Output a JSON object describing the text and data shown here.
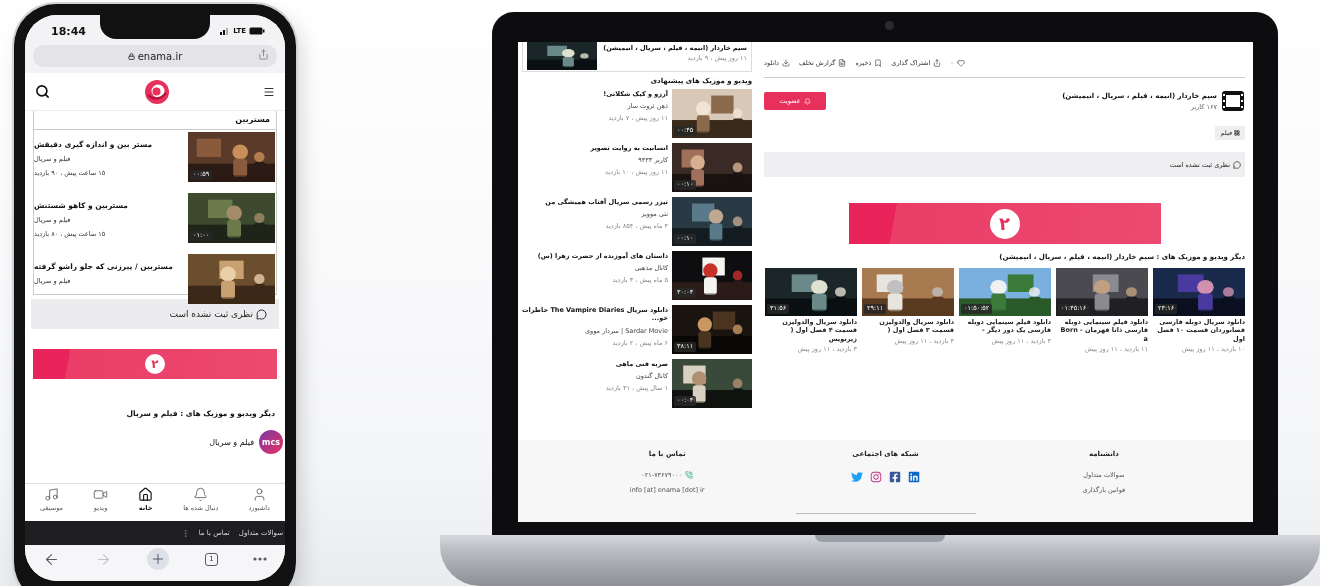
{
  "phone": {
    "status": {
      "time": "18:44",
      "network": "LTE"
    },
    "address": "enama.ir",
    "section_title": "مستربین",
    "videos": [
      {
        "title": "مستر بین و اندازه گیری دقیقش",
        "channel": "فیلم و سریال",
        "meta": "۱۵ ساعت پیش ، ۹۰ بازدید",
        "duration": "۰۰:۵۹"
      },
      {
        "title": "مستربین و کاهو شستنش",
        "channel": "فیلم و سریال",
        "meta": "۱۵ ساعت پیش ، ۸۰ بازدید",
        "duration": "۰۱:۰۰"
      },
      {
        "title": "مستربین / پیرزنی که جلو راشو گرفته",
        "channel": "فیلم و سریال"
      }
    ],
    "comments": "نظری ثبت نشده است",
    "pager": "۲",
    "related_heading": "دیگر ویدیو و موزیک های : فیلم و سریال",
    "channel": {
      "logo": "mcs",
      "name": "فیلم و سریال"
    },
    "nav": [
      {
        "kind": "user",
        "label": "داشبورد",
        "selected": false
      },
      {
        "kind": "bell",
        "label": "دنبال شده ها",
        "selected": false
      },
      {
        "kind": "home",
        "label": "خانه",
        "selected": true
      },
      {
        "kind": "video",
        "label": "ویدیو",
        "selected": false
      },
      {
        "kind": "music",
        "label": "موسیقی",
        "selected": false
      }
    ],
    "footer_links": [
      "سوالات متداول",
      "تماس با ما"
    ],
    "browser": {
      "tab_count": "1",
      "forward_disabled": true
    }
  },
  "laptop": {
    "sidebar": {
      "top_card": {
        "title": "سیم خاردار (انیمه ، فیلم ، سریال ، انیمیشن)",
        "meta": "۱۱ روز پیش ، ۹ بازدید"
      },
      "heading": "ویدیو و موزیک های پیشنهادی",
      "items": [
        {
          "title": "آرزو و کیک شکلاتی!",
          "channel": "ذهن ثروت ساز",
          "meta": "۱۱ روز پیش ، ۷ بازدید",
          "duration": "۰۰:۴۵"
        },
        {
          "title": "انسانیت به روایت تصویر",
          "channel": "کاربر ۹۴۳۳",
          "meta": "۱۱ روز پیش ، ۱۰ بازدید",
          "duration": "۰۰:۱۰"
        },
        {
          "title": "تیزر رسمی سریال آفتاب همیشگی من",
          "channel": "نتی موویز",
          "meta": "۴ ماه پیش ، ۸۵۴ بازدید",
          "duration": "۰۰:۱۰"
        },
        {
          "title": "داستان های آموزنده از حضرت زهرا (س)",
          "channel": "کانال مذهبی",
          "meta": "۵ ماه پیش ، ۳ بازدید",
          "duration": "۳۰:۰۴"
        },
        {
          "title": "دانلود سریال The Vampire Diaries خاطرات خو...",
          "channel": "Sardar Movie | سردار مووی",
          "meta": "۶ ماه پیش ، ۲ بازدید",
          "duration": "۳۸:۱۱"
        },
        {
          "title": "ضربه فنی ماهی",
          "channel": "کانال گندون",
          "meta": "۱ سال پیش ، ۳۱ بازدید",
          "duration": "۰۰:۰۴"
        }
      ]
    },
    "actions": [
      {
        "kind": "like",
        "label": "۰"
      },
      {
        "kind": "share",
        "label": "اشتراک گذاری"
      },
      {
        "kind": "save",
        "label": "ذخیره"
      },
      {
        "kind": "report",
        "label": "گزارش تخلف"
      },
      {
        "kind": "download",
        "label": "دانلود"
      }
    ],
    "channel": {
      "name": "سیم خاردار (انیمه ، فیلم ، سریال ، انیمیشن)",
      "members": "۱۶۷ کاربر",
      "join": "عضویت"
    },
    "tag": "فیلم",
    "comments": "نظری ثبت نشده است",
    "pager": "۲",
    "related_heading": "دیگر ویدیو و موزیک های : سیم خاردار (انیمه ، فیلم ، سریال ، انیمیشن)",
    "related": [
      {
        "duration": "۲۴:۱۶",
        "title": "دانلود سریال دوبله فارسی فضانوردان قسمت ۱۰ فصل اول",
        "meta": "۱۰ بازدید ، ۱۱ روز پیش"
      },
      {
        "duration": "۰۱:۴۵:۱۶",
        "title": "دانلود فیلم سینمایی دوبله فارسی ذاتا قهرمان - Born a",
        "meta": "۱۱ بازدید ، ۱۱ روز پیش"
      },
      {
        "duration": "۰۱:۵۰:۵۲",
        "title": "دانلود فیلم سینمایی دوبله فارسی یک دور دیگر -",
        "meta": "۴ بازدید ، ۱۱ روز پیش"
      },
      {
        "duration": "۲۹:۱۱",
        "title": "دانلود سریال والدولیزن قسمت ۳ فصل اول (",
        "meta": "۴ بازدید ، ۱۱ روز پیش"
      },
      {
        "duration": "۳۱:۵۶",
        "title": "دانلود سریال والدولیزن قسمت ۴ فصل اول ( زیرنویس",
        "meta": "۳ بازدید ، ۱۱ روز پیش"
      }
    ],
    "footer": {
      "contact": {
        "heading": "تماس با ما",
        "phone": "۰۲۱-۷۳۶۷۹۰۰۰",
        "email": "info [at] enama [dot] ir"
      },
      "social": {
        "heading": "شبکه های اجتماعی",
        "links": [
          {
            "kind": "linkedin"
          },
          {
            "kind": "facebook"
          },
          {
            "kind": "instagram"
          },
          {
            "kind": "twitter"
          }
        ]
      },
      "wiki": {
        "heading": "دانشنامه",
        "links": [
          "سوالات متداول",
          "قوانین بارگذاری"
        ]
      }
    }
  }
}
